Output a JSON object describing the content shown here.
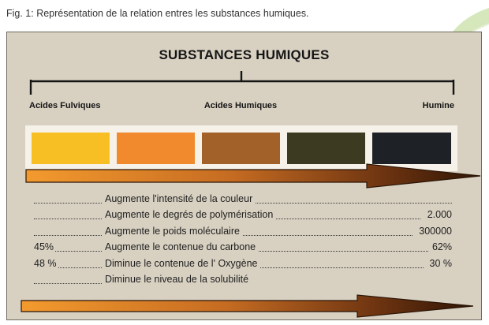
{
  "figure_caption": "Fig. 1: Représentation de la relation entres les substances humiques.",
  "diagram": {
    "title": "SUBSTANCES HUMIQUES",
    "labels": {
      "left": "Acides Fulviques",
      "middle": "Acides Humiques",
      "right": "Humine"
    },
    "swatch_colors": [
      "#f7bf23",
      "#f08a2c",
      "#a3612a",
      "#3c3a20",
      "#1e2126"
    ],
    "arrow_gradient": [
      "#f39a2e",
      "#c66c22",
      "#6a3210",
      "#2f1504"
    ],
    "rows": [
      {
        "prefix": "",
        "label": "Augmente l'intensité de la couleur",
        "end": ""
      },
      {
        "prefix": "",
        "label": "Augmente le degrés de polymérisation",
        "end": "2.000"
      },
      {
        "prefix": "",
        "label": "Augmente le poids moléculaire",
        "end": "300000"
      },
      {
        "prefix": "45%",
        "label": "Augmente le contenue du carbone",
        "end": "62%"
      },
      {
        "prefix": "48 %",
        "label": "Diminue le contenue de l' Oxygène",
        "end": "30 %"
      },
      {
        "prefix": "",
        "label": "Diminue le niveau de la solubilité",
        "end": ""
      }
    ]
  }
}
